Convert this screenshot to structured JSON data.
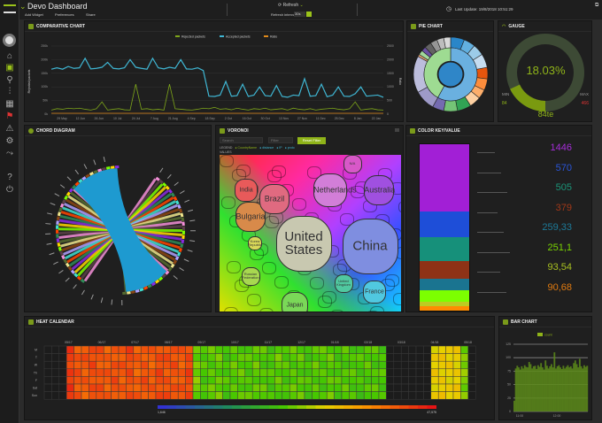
{
  "header": {
    "title": "Devo Dashboard",
    "add_widget": "Add Widget",
    "preferences": "Preferences",
    "share": "Share",
    "refresh": "Refresh",
    "refresh_interval_label": "Refresh interval",
    "refresh_interval": "30s",
    "last_update": "Last Update: 19/8/2018 10:51:29"
  },
  "sidebar": {
    "items": [
      "avatar",
      "home",
      "dashboard",
      "search",
      "filters",
      "grid",
      "alerts",
      "warnings",
      "settings",
      "share",
      "help",
      "power"
    ]
  },
  "comparative": {
    "title": "COMPARATIVE CHART",
    "legend": [
      "Rejected packets",
      "Accepted packets",
      "Ratio"
    ],
    "colors": [
      "#7da51a",
      "#3fb6d3",
      "#e08a1a"
    ],
    "ylabel": "Rejected packets",
    "y2label": "Ratio",
    "yticks": [
      "0k",
      "50k",
      "100k",
      "150k",
      "200k",
      "250k"
    ],
    "y2ticks": [
      "0",
      "500",
      "1000",
      "1500",
      "2000",
      "2500"
    ],
    "xticks": [
      "29 May",
      "12 Jun",
      "26 Jun",
      "10 Jul",
      "24 Jul",
      "7 Aug",
      "21 Aug",
      "4 Sep",
      "18 Sep",
      "2 Oct",
      "16 Oct",
      "30 Oct",
      "13 Nov",
      "27 Nov",
      "11 Dec",
      "25 Dec",
      "8 Jan",
      "22 Jan"
    ],
    "accepted": [
      165,
      170,
      165,
      175,
      168,
      170,
      205,
      166,
      168,
      172,
      190,
      168,
      166,
      170,
      200,
      172,
      168,
      165,
      205,
      170,
      166,
      172,
      168,
      200,
      166,
      165,
      170,
      160,
      66,
      65,
      70,
      120,
      66,
      68,
      110,
      65,
      70,
      100,
      68,
      66,
      105,
      65,
      62,
      70,
      68,
      130,
      66,
      68,
      110,
      64,
      70,
      100,
      66,
      65,
      75,
      100,
      66,
      68,
      70,
      62
    ],
    "rejected": [
      15,
      20,
      18,
      22,
      20,
      22,
      18,
      15,
      20,
      45,
      15,
      18,
      20,
      16,
      15,
      110,
      18,
      20,
      16,
      18,
      15,
      110,
      20,
      18,
      16,
      15,
      18,
      22,
      20,
      25,
      18,
      20,
      16,
      22,
      18,
      15,
      20,
      18,
      22,
      16,
      18,
      20,
      15,
      22,
      18,
      16,
      20,
      15,
      18,
      20,
      22,
      18,
      16,
      20,
      45,
      15,
      18,
      20,
      16,
      15
    ]
  },
  "pie": {
    "title": "PIE CHART",
    "inner": [
      {
        "v": 100,
        "c": "#2f86c8"
      }
    ],
    "middle": [
      {
        "v": 58,
        "c": "#6ab0e0"
      },
      {
        "v": 42,
        "c": "#9edb92"
      }
    ],
    "outer": [
      {
        "v": 6,
        "c": "#2a86c8"
      },
      {
        "v": 5,
        "c": "#62b0e0"
      },
      {
        "v": 5,
        "c": "#9ccbe8"
      },
      {
        "v": 6,
        "c": "#c5dcf0"
      },
      {
        "v": 5,
        "c": "#e6550d"
      },
      {
        "v": 5,
        "c": "#fd8d3c"
      },
      {
        "v": 4,
        "c": "#fdae6b"
      },
      {
        "v": 5,
        "c": "#fdd0a2"
      },
      {
        "v": 6,
        "c": "#31a354"
      },
      {
        "v": 6,
        "c": "#74c476"
      },
      {
        "v": 5,
        "c": "#756bb1"
      },
      {
        "v": 9,
        "c": "#9e9ac8"
      },
      {
        "v": 16,
        "c": "#bcbddc"
      },
      {
        "v": 1,
        "c": "#e0a070"
      },
      {
        "v": 2,
        "c": "#a1d99b"
      },
      {
        "v": 2,
        "c": "#6a51a3"
      },
      {
        "v": 3,
        "c": "#636363"
      },
      {
        "v": 3,
        "c": "#969696"
      },
      {
        "v": 3,
        "c": "#bdbdbd"
      },
      {
        "v": 3,
        "c": "#d9d9d9"
      }
    ]
  },
  "gauge": {
    "title": "GAUGE",
    "value_text": "18.03%",
    "value": 18.03,
    "min_label": "MIN",
    "max_label": "MAX",
    "min": "84",
    "max": "466",
    "footer": "84te"
  },
  "chord": {
    "title": "CHORD DIAGRAM"
  },
  "voronoi": {
    "title": "VORONOI",
    "search_placeholder": "Search",
    "filter_placeholder": "Filter",
    "reset_button": "Reset Filter",
    "legend_label": "LEGEND",
    "legend_items": [
      "CountryName",
      "distance",
      "IP",
      "proto"
    ],
    "breadcrumb": "VALUES",
    "cells": [
      {
        "label": "United States",
        "size": 15,
        "c": "#c8c8b0"
      },
      {
        "label": "China",
        "size": 15,
        "c": "#7f8ee0"
      },
      {
        "label": "Netherlands",
        "size": 9,
        "c": "#d27ed8"
      },
      {
        "label": "Australia",
        "size": 8,
        "c": "#a050e0"
      },
      {
        "label": "Bulgaria",
        "size": 8,
        "c": "#d88a4a"
      },
      {
        "label": "Brazil",
        "size": 8,
        "c": "#e06a80"
      },
      {
        "label": "India",
        "size": 6,
        "c": "#e85a5a"
      },
      {
        "label": "N/A",
        "size": 5,
        "c": "#d858c8"
      },
      {
        "label": "Japan",
        "size": 7,
        "c": "#7ad858"
      },
      {
        "label": "Russian Federation",
        "size": 5,
        "c": "#a8d850"
      },
      {
        "label": "United Kingdom",
        "size": 5,
        "c": "#50c8a0"
      },
      {
        "label": "France",
        "size": 6,
        "c": "#50c8e0"
      },
      {
        "label": "Korea Republic",
        "size": 4,
        "c": "#d8d858"
      }
    ]
  },
  "colorkey": {
    "title": "COLOR KEY/VALUE",
    "items": [
      {
        "v": 1446,
        "t": "1446",
        "c": "#a21fd6",
        "tc": "#a62dd8"
      },
      {
        "v": 570,
        "t": "570",
        "c": "#1e4ed8",
        "tc": "#2a55d8"
      },
      {
        "v": 505,
        "t": "505",
        "c": "#16907a",
        "tc": "#1b9478"
      },
      {
        "v": 379,
        "t": "379",
        "c": "#8e3216",
        "tc": "#a23818"
      },
      {
        "v": 259.33,
        "t": "259,33",
        "c": "#1a7490",
        "tc": "#1d7a98"
      },
      {
        "v": 251.1,
        "t": "251,1",
        "c": "#7cff00",
        "tc": "#7ad400"
      },
      {
        "v": 93.54,
        "t": "93,54",
        "c": "#bccc22",
        "tc": "#a8c020"
      },
      {
        "v": 90.68,
        "t": "90,68",
        "c": "#ff8c00",
        "tc": "#e07a10"
      }
    ]
  },
  "heat": {
    "title": "HEAT CALENDAR",
    "months": [
      "05/17",
      "06/17",
      "07/17",
      "08/17",
      "09/17",
      "10/17",
      "11/17",
      "12/17",
      "01/18",
      "02/18",
      "03/18",
      "04/18",
      "05/18"
    ],
    "days": [
      "M",
      "T",
      "W",
      "Th",
      "F",
      "Sat",
      "Sun"
    ],
    "min_label": "1,646",
    "max_label": "47,575",
    "weeks": [
      -1,
      -1,
      -1,
      0.93,
      0.88,
      0.87,
      0.9,
      0.88,
      0.86,
      0.89,
      0.87,
      0.9,
      0.86,
      0.88,
      0.87,
      0.9,
      0.88,
      0.89,
      0.87,
      0.9,
      0.5,
      0.45,
      0.46,
      0.48,
      0.44,
      0.46,
      0.47,
      0.45,
      0.48,
      0.46,
      0.44,
      0.47,
      0.45,
      0.46,
      0.47,
      0.44,
      0.46,
      0.45,
      0.47,
      0.44,
      0.46,
      0.45,
      0.44,
      0.46,
      0.45,
      0.44,
      -2,
      -2,
      -2,
      -2,
      -2,
      -2,
      0.62,
      0.62,
      0.62,
      0.62,
      0.5,
      -2
    ]
  },
  "bar": {
    "title": "BAR CHART",
    "legend": "count",
    "yticks": [
      "0",
      "25",
      "50",
      "75",
      "100",
      "125"
    ],
    "xticks": [
      "11:00",
      "12:00"
    ],
    "ymax": 125,
    "values": [
      20,
      80,
      85,
      82,
      78,
      84,
      80,
      86,
      83,
      82,
      92,
      88,
      80,
      84,
      85,
      79,
      86,
      83,
      90,
      82,
      78,
      95,
      85,
      80,
      84,
      88,
      82,
      110,
      80,
      84,
      86,
      82,
      79,
      85,
      80,
      83,
      86,
      82,
      84,
      80,
      90,
      95,
      88,
      82,
      98,
      84,
      80,
      86,
      83,
      85
    ]
  }
}
